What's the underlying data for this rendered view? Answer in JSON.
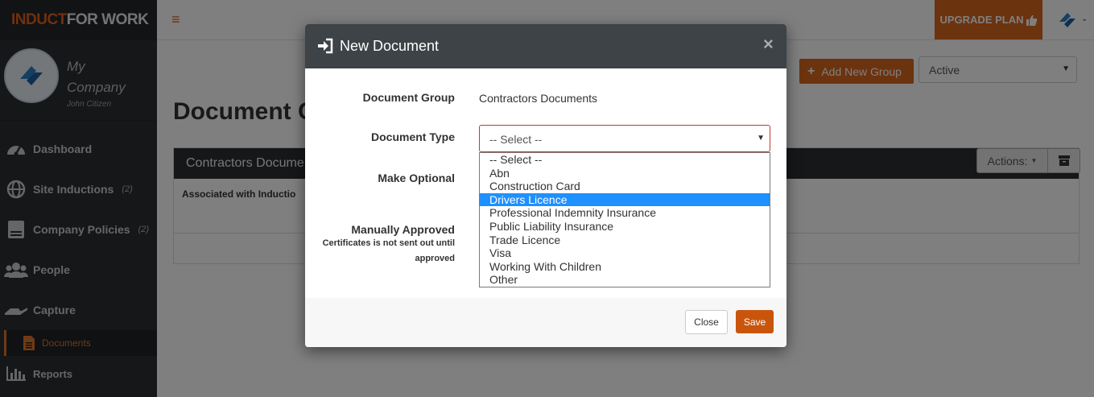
{
  "brand": {
    "part1": "INDUCT",
    "part2": "FOR WORK"
  },
  "profile": {
    "company_line1": "My",
    "company_line2": "Company",
    "user": "John Citizen"
  },
  "sidebar": {
    "items": [
      {
        "label": "Dashboard",
        "count": "",
        "icon": "dashboard-icon"
      },
      {
        "label": "Site Inductions",
        "count": "(2)",
        "icon": "globe-icon"
      },
      {
        "label": "Company Policies",
        "count": "(2)",
        "icon": "policies-icon"
      },
      {
        "label": "People",
        "count": "",
        "icon": "people-icon"
      },
      {
        "label": "Capture",
        "count": "",
        "icon": "hand-icon"
      }
    ],
    "sub_item": {
      "label": "Documents",
      "icon": "document-icon"
    },
    "reports": {
      "label": "Reports",
      "icon": "chart-icon"
    }
  },
  "topbar": {
    "menu_icon": "≡",
    "upgrade_label": "UPGRADE PLAN",
    "upgrade_icon": "thumbs-up-icon"
  },
  "main": {
    "add_group_label": "Add New Group",
    "status_value": "Active",
    "page_title": "Document G",
    "panel_title": "Contractors Docume",
    "actions_label": "Actions:",
    "panel_sub": "Associated with Inductio"
  },
  "modal": {
    "title": "New Document",
    "close_symbol": "×",
    "labels": {
      "group": "Document Group",
      "type": "Document Type",
      "optional": "Make Optional",
      "approved": "Manually Approved",
      "approved_note1": "Certificates is not sent out until",
      "approved_note2": "approved"
    },
    "group_value": "Contractors Documents",
    "type_value": "-- Select --",
    "options": [
      "-- Select --",
      "Abn",
      "Construction Card",
      "Drivers Licence",
      "Professional Indemnity Insurance",
      "Public Liability Insurance",
      "Trade Licence",
      "Visa",
      "Working With Children",
      "Other"
    ],
    "highlighted_option": "Drivers Licence",
    "buttons": {
      "close": "Close",
      "save": "Save"
    }
  },
  "colors": {
    "accent": "#d9661e",
    "sidebar": "#2b2f33",
    "highlight": "#1e90ff",
    "modal_header": "#3d4346"
  }
}
